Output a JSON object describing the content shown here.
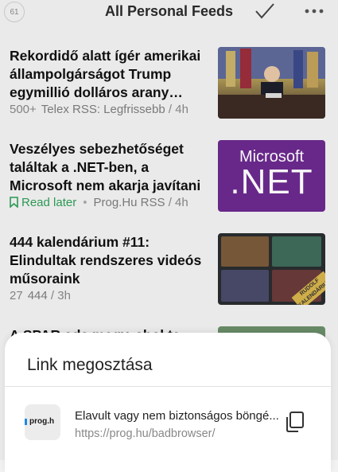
{
  "header": {
    "unread_count": "61",
    "title": "All Personal Feeds",
    "icons": [
      "check-icon",
      "more-icon"
    ]
  },
  "articles": [
    {
      "title": "Rekordidő alatt ígér amerikai állampolgárságot Trump egymillió dolláros arany…",
      "count": "500+",
      "source": "Telex RSS: Legfrissebb",
      "age": "4h"
    },
    {
      "title": "Veszélyes sebezhetőséget találtak a .NET-ben, a Microsoft nem akarja javítani",
      "status": "Read later",
      "source": "Prog.Hu RSS",
      "age": "4h",
      "thumb_text_small": "Microsoft",
      "thumb_text_big": ".NET"
    },
    {
      "title": "444 kalendárium #11: Elindultak rendszeres videós műsoraink",
      "count": "27",
      "source": "444",
      "age": "3h",
      "thumb_stamp": "RUDOLF KALENDÁRIUM"
    },
    {
      "title": "A SPAR ade megy, ahol te..."
    }
  ],
  "share_sheet": {
    "title": "Link megosztása",
    "favicon_text": "prog.h",
    "link_title": "Elavult vagy nem biztonságos böngé...",
    "link_url": "https://prog.hu/badbrowser/",
    "icons": [
      "copy-icon"
    ]
  },
  "colors": {
    "read_later": "#2e9d57",
    "net_purple": "#6c2a8f",
    "background": "#f2f2f2"
  }
}
